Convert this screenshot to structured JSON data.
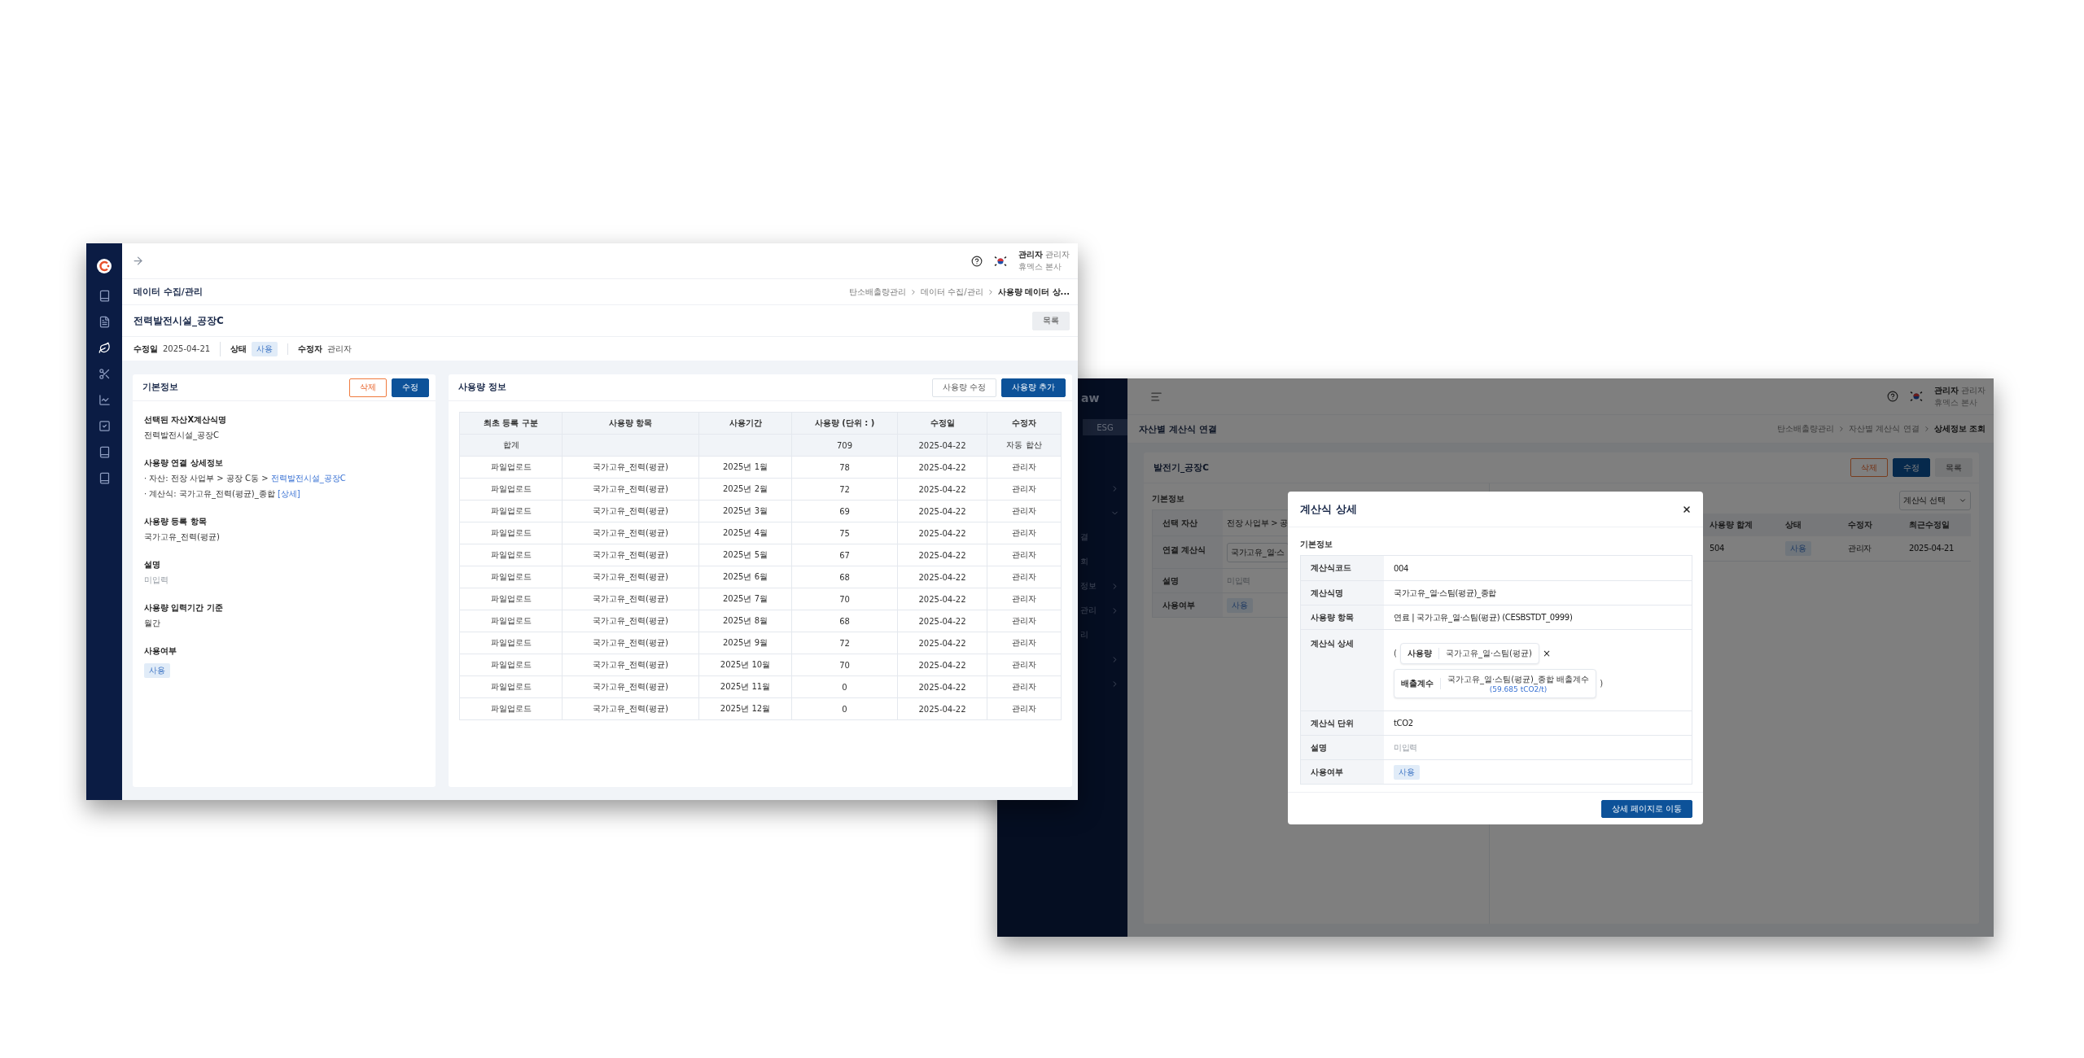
{
  "usage_window": {
    "nav_items": [
      {
        "selected": false
      },
      {
        "selected": false
      },
      {
        "selected": true
      },
      {
        "selected": false
      },
      {
        "selected": false
      },
      {
        "selected": false
      },
      {
        "selected": false
      },
      {
        "selected": false
      }
    ],
    "user": {
      "name": "관리자",
      "role": "관리자",
      "company": "휴멕스 본사"
    },
    "page_title": "데이터 수집/관리",
    "breadcrumb": [
      "탄소배출량관리",
      "데이터 수집/관리",
      "사용량 데이터 상..."
    ],
    "record_title": "전력발전시설_공장C",
    "list_button": "목록",
    "meta": [
      {
        "label": "수정일",
        "kind": "text",
        "value": "2025-04-21"
      },
      {
        "label": "상태",
        "kind": "badge",
        "value": "사용"
      },
      {
        "label": "수정자",
        "kind": "text",
        "value": "관리자"
      }
    ],
    "basic_info": {
      "title": "기본정보",
      "buttons": [
        {
          "label": "삭제",
          "kind": "danger"
        },
        {
          "label": "수정",
          "kind": "primary"
        }
      ],
      "fields": [
        {
          "label": "선택된 자산X계산식명",
          "kind": "text",
          "value": "전력발전시설_공장C"
        },
        {
          "label": "사용량 연결 상세정보",
          "kind": "lines",
          "lines": [
            {
              "text": "· 자산: 전장 사업부 > 공장 C동 > ",
              "link": "전력발전시설_공장C"
            },
            {
              "text": "· 계산식: 국가고유_전력(평균)_종합 ",
              "link": "[상세]"
            }
          ]
        },
        {
          "label": "사용량 등록 항목",
          "kind": "text",
          "value": "국가고유_전력(평균)"
        },
        {
          "label": "설명",
          "kind": "muted",
          "value": "미입력"
        },
        {
          "label": "사용량 입력기간 기준",
          "kind": "text",
          "value": "월간"
        },
        {
          "label": "사용여부",
          "kind": "badge",
          "value": "사용"
        }
      ]
    },
    "usage_info": {
      "title": "사용량 정보",
      "buttons": [
        {
          "label": "사용량 수정",
          "kind": "outline"
        },
        {
          "label": "사용량 추가",
          "kind": "primary"
        }
      ],
      "columns": [
        "최초 등록 구분",
        "사용량 항목",
        "사용기간",
        "사용량 (단위 : )",
        "수정일",
        "수정자"
      ],
      "rows": [
        {
          "kind": "total",
          "cells": [
            "합계",
            null,
            null,
            "709",
            "2025-04-22",
            "자동 합산"
          ]
        },
        {
          "kind": "data",
          "cells": [
            "파일업로드",
            "국가고유_전력(평균)",
            "2025년 1월",
            "78",
            "2025-04-22",
            "관리자"
          ]
        },
        {
          "kind": "data",
          "cells": [
            "파일업로드",
            "국가고유_전력(평균)",
            "2025년 2월",
            "72",
            "2025-04-22",
            "관리자"
          ]
        },
        {
          "kind": "data",
          "cells": [
            "파일업로드",
            "국가고유_전력(평균)",
            "2025년 3월",
            "69",
            "2025-04-22",
            "관리자"
          ]
        },
        {
          "kind": "data",
          "cells": [
            "파일업로드",
            "국가고유_전력(평균)",
            "2025년 4월",
            "75",
            "2025-04-22",
            "관리자"
          ]
        },
        {
          "kind": "data",
          "cells": [
            "파일업로드",
            "국가고유_전력(평균)",
            "2025년 5월",
            "67",
            "2025-04-22",
            "관리자"
          ]
        },
        {
          "kind": "data",
          "cells": [
            "파일업로드",
            "국가고유_전력(평균)",
            "2025년 6월",
            "68",
            "2025-04-22",
            "관리자"
          ]
        },
        {
          "kind": "data",
          "cells": [
            "파일업로드",
            "국가고유_전력(평균)",
            "2025년 7월",
            "70",
            "2025-04-22",
            "관리자"
          ]
        },
        {
          "kind": "data",
          "cells": [
            "파일업로드",
            "국가고유_전력(평균)",
            "2025년 8월",
            "68",
            "2025-04-22",
            "관리자"
          ]
        },
        {
          "kind": "data",
          "cells": [
            "파일업로드",
            "국가고유_전력(평균)",
            "2025년 9월",
            "72",
            "2025-04-22",
            "관리자"
          ]
        },
        {
          "kind": "data",
          "cells": [
            "파일업로드",
            "국가고유_전력(평균)",
            "2025년 10월",
            "70",
            "2025-04-22",
            "관리자"
          ]
        },
        {
          "kind": "data",
          "cells": [
            "파일업로드",
            "국가고유_전력(평균)",
            "2025년 11월",
            "0",
            "2025-04-22",
            "관리자"
          ]
        },
        {
          "kind": "data",
          "cells": [
            "파일업로드",
            "국가고유_전력(평균)",
            "2025년 12월",
            "0",
            "2025-04-22",
            "관리자"
          ]
        }
      ]
    }
  },
  "formula_window": {
    "sidebar": {
      "logo_text": "aw",
      "tab": "ESG",
      "items": [
        {
          "expanded": false
        },
        {
          "expanded": true
        },
        {
          "label": "결"
        },
        {
          "label": "회"
        },
        {
          "label": "정보",
          "expanded": false
        },
        {
          "label": "관리",
          "expanded": false
        },
        {
          "label": "리"
        },
        {
          "expanded": false
        },
        {
          "expanded": false
        }
      ]
    },
    "user": {
      "name": "관리자",
      "role": "관리자",
      "company": "휴멕스 본사"
    },
    "page_title": "자산별 계산식 연결",
    "breadcrumb": [
      "탄소배출량관리",
      "자산별 계산식 연결",
      "상세정보 조회"
    ],
    "card": {
      "title": "발전기_공장C",
      "buttons": [
        {
          "label": "삭제",
          "kind": "danger"
        },
        {
          "label": "수정",
          "kind": "primary"
        },
        {
          "label": "목록",
          "kind": "secondary"
        }
      ],
      "section_title": "기본정보",
      "fields": [
        {
          "label": "선택 자산",
          "kind": "text",
          "value": "전장 사업부 > 공"
        },
        {
          "label": "연결 계산식",
          "kind": "select",
          "value": "국가고유_열·스"
        },
        {
          "label": "설명",
          "kind": "muted",
          "value": "미입력"
        },
        {
          "label": "사용여부",
          "kind": "badge",
          "value": "사용"
        }
      ],
      "formula_select": "계산식 선택",
      "columns": [
        "사용량 합계",
        "상태",
        "수정자",
        "최근수정일"
      ],
      "rows": [
        {
          "cells": [
            {
              "kind": "text",
              "value": "504"
            },
            {
              "kind": "badge",
              "value": "사용"
            },
            {
              "kind": "text",
              "value": "관리자"
            },
            {
              "kind": "text",
              "value": "2025-04-21"
            }
          ]
        }
      ]
    },
    "modal": {
      "title": "계산식 상세",
      "section_title": "기본정보",
      "fields": [
        {
          "label": "계산식코드",
          "kind": "text",
          "value": "004"
        },
        {
          "label": "계산식명",
          "kind": "text",
          "value": "국가고유_열·스팀(평균)_종합"
        },
        {
          "label": "사용량 항목",
          "kind": "text",
          "value": "연료 | 국가고유_열·스팀(평균) (CESBSTDT_0999)"
        },
        {
          "label": "계산식 상세",
          "kind": "formula",
          "formula": {
            "open": "(",
            "operator": "×",
            "close": ")",
            "terms": [
              {
                "label": "사용량",
                "value": "국가고유_열·스팀(평균)"
              },
              {
                "label": "배출계수",
                "value": "국가고유_열·스팀(평균)_종합 배출계수",
                "note": "(59.685 tCO2/t)"
              }
            ]
          }
        },
        {
          "label": "계산식 단위",
          "kind": "text",
          "value": "tCO2"
        },
        {
          "label": "설명",
          "kind": "muted",
          "value": "미입력"
        },
        {
          "label": "사용여부",
          "kind": "badge",
          "value": "사용"
        }
      ],
      "action": "상세 페이지로 이동"
    }
  }
}
